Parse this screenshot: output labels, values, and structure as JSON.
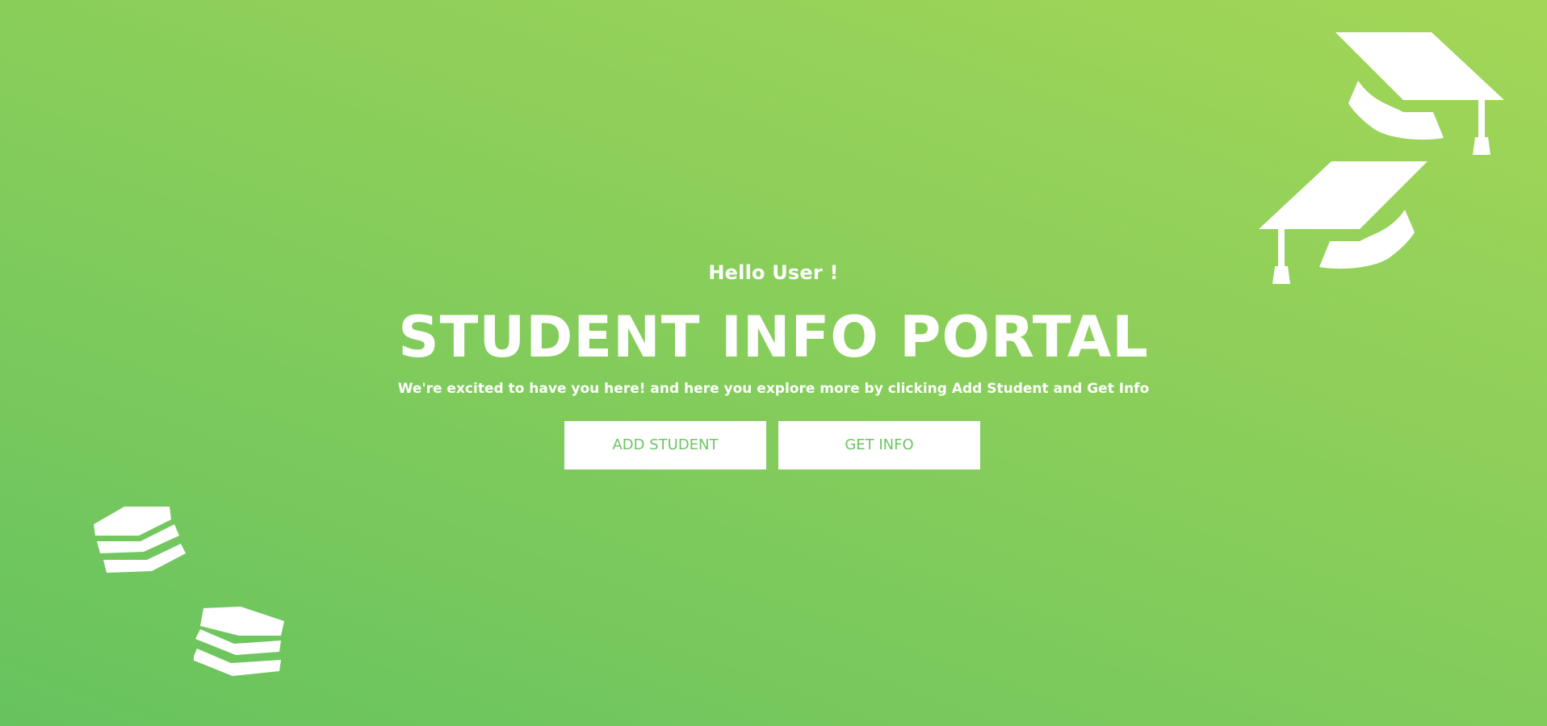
{
  "hero": {
    "greeting": "Hello User !",
    "title": "STUDENT INFO PORTAL",
    "subtitle": "We're excited to have you here! and here you explore more by clicking Add Student and Get Info"
  },
  "buttons": {
    "add_student": "ADD STUDENT",
    "get_info": "GET INFO"
  },
  "decorations": {
    "top_right_icons": [
      "graduation-cap-icon",
      "graduation-cap-icon"
    ],
    "bottom_left_icons": [
      "book-stack-icon",
      "book-stack-icon"
    ]
  },
  "colors": {
    "background_gradient": [
      "#67c35f",
      "#a3d657"
    ],
    "button_background": "#ffffff",
    "button_text": "#6cc562",
    "text": "#ffffff"
  }
}
